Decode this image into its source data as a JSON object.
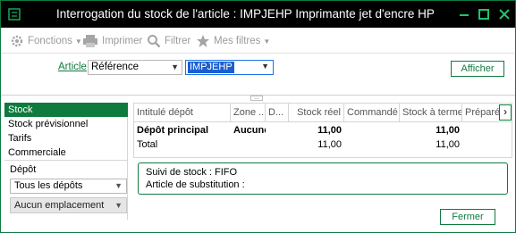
{
  "window": {
    "title": "Interrogation du stock de l'article : IMPJEHP Imprimante jet d'encre HP"
  },
  "toolbar": {
    "fonctions": "Fonctions",
    "imprimer": "Imprimer",
    "filtrer": "Filtrer",
    "mes_filtres": "Mes filtres"
  },
  "search": {
    "article_label": "Article",
    "field_selected": "Référence",
    "value": "IMPJEHP",
    "afficher_label": "Afficher"
  },
  "nav": {
    "items": [
      "Stock",
      "Stock prévisionnel",
      "Tarifs",
      "Commerciale"
    ],
    "active_index": 0
  },
  "filters": {
    "depot_label": "Dépôt",
    "depot_selected": "Tous les dépôts",
    "emplacement_selected": "Aucun emplacement"
  },
  "grid": {
    "columns": [
      "Intitulé dépôt",
      "Zone ...",
      "D...",
      "Stock réel",
      "Commandé",
      "Stock à terme",
      "Préparé"
    ],
    "rows": [
      {
        "depot": "Dépôt principal",
        "zone": "Aucune",
        "d": "",
        "stock_reel": "11,00",
        "commande": "",
        "stock_terme": "11,00",
        "prepare": ""
      },
      {
        "depot": "Total",
        "zone": "",
        "d": "",
        "stock_reel": "11,00",
        "commande": "",
        "stock_terme": "11,00",
        "prepare": ""
      }
    ]
  },
  "info": {
    "suivi": "Suivi de stock : FIFO",
    "substitution": "Article de substitution :"
  },
  "footer": {
    "fermer_label": "Fermer"
  },
  "colors": {
    "accent": "#0f7a3e",
    "titlebar": "#000000",
    "selection": "#1a5fd1"
  }
}
